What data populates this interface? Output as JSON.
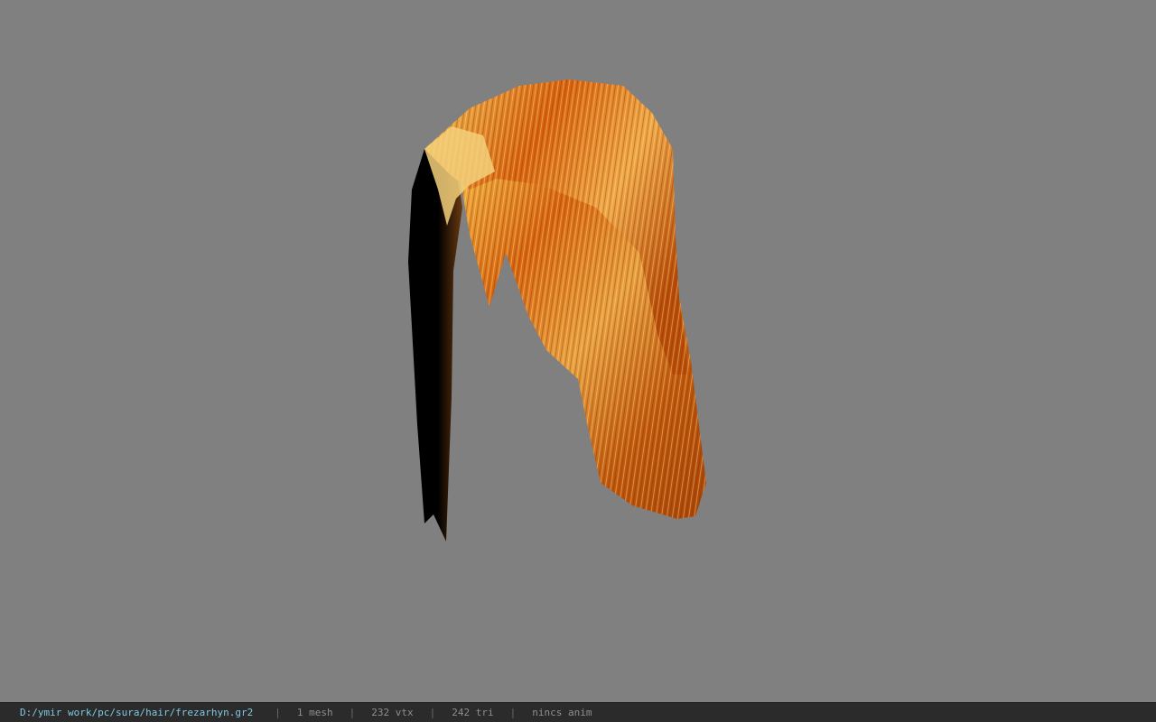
{
  "viewer": {
    "background_color": "#808080",
    "model_name": "hair-model"
  },
  "status": {
    "path": "D:/ymir work/pc/sura/hair/frezarhyn.gr2",
    "separator": "|",
    "mesh": "1 mesh",
    "vertices": "232 vtx",
    "triangles": "242 tri",
    "anim": "nincs anim"
  },
  "colors": {
    "hair_light": "#f2c45a",
    "hair_mid": "#e07a1a",
    "hair_dark": "#8a3608",
    "shadow": "#000000",
    "path_text": "#7ec8e3"
  }
}
